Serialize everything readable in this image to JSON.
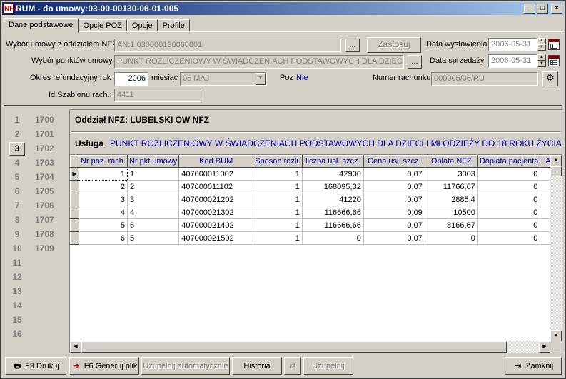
{
  "window": {
    "title": "RUM - do umowy:03-00-00130-06-01-005",
    "app_icon": "NFZ"
  },
  "tabs": [
    {
      "label": "Dane podstawowe",
      "active": true
    },
    {
      "label": "Opcje POZ"
    },
    {
      "label": "Opcje"
    },
    {
      "label": "Profile"
    }
  ],
  "form": {
    "umowa_label": "Wybór umowy z oddziałem NFZ",
    "umowa_value": "AN:1 030000130060001",
    "punkt_label": "Wybór punktów umowy",
    "punkt_value": "PUNKT ROZLICZENIOWY W ŚWIADCZENIACH PODSTAWOWYCH DLA DZIECI",
    "ellipsis": "...",
    "zastosuj": "Zastosuj",
    "data_wyst_label": "Data wystawienia",
    "data_wyst_value": "2006-05-31",
    "data_sprz_label": "Data sprzedaży",
    "data_sprz_value": "2006-05-31",
    "okres_label": "Okres refundacyjny",
    "rok_label": "rok",
    "rok_value": "2006",
    "miesiac_label": "miesiąc",
    "miesiac_value": "05 MAJ",
    "poz_label": "Poz",
    "poz_value": "Nie",
    "numer_label": "Numer rachunku",
    "numer_value": "000005/06/RU",
    "szablon_label": "Id Szablonu rach.:",
    "szablon_value": "4411"
  },
  "left_list": [
    {
      "n": "1",
      "v": "1700"
    },
    {
      "n": "2",
      "v": "1701"
    },
    {
      "n": "3",
      "v": "1702",
      "selected": true
    },
    {
      "n": "4",
      "v": "1703"
    },
    {
      "n": "5",
      "v": "1704"
    },
    {
      "n": "6",
      "v": "1705"
    },
    {
      "n": "7",
      "v": "1706"
    },
    {
      "n": "8",
      "v": "1707"
    },
    {
      "n": "9",
      "v": "1708"
    },
    {
      "n": "10",
      "v": "1709"
    },
    {
      "n": "11",
      "v": ""
    },
    {
      "n": "12",
      "v": ""
    },
    {
      "n": "13",
      "v": ""
    },
    {
      "n": "14",
      "v": ""
    },
    {
      "n": "15",
      "v": ""
    },
    {
      "n": "16",
      "v": ""
    }
  ],
  "main": {
    "oddzial": "Oddział NFZ: LUBELSKI OW NFZ",
    "usluga_label": "Usługa",
    "usluga_value": "PUNKT ROZLICZENIOWY W ŚWIADCZENIACH PODSTAWOWYCH DLA DZIECI I MŁODZIEŻY DO 18 ROKU ŻYCIA"
  },
  "grid": {
    "columns": [
      "Nr poz. rach.",
      "Nr pkt umowy",
      "Kod BUM",
      "Sposob rozli.",
      "liczba usł. szcz.",
      "Cena usł. szcz.",
      "Opłata NFZ",
      "Dopłata pacjenta",
      "'A'"
    ],
    "rows": [
      [
        "1",
        "1",
        "407000011002",
        "1",
        "42900",
        "0,07",
        "3003",
        "0"
      ],
      [
        "2",
        "2",
        "407000011102",
        "1",
        "168095,32",
        "0,07",
        "11766,67",
        "0"
      ],
      [
        "3",
        "3",
        "407000021202",
        "1",
        "41220",
        "0,07",
        "2885,4",
        "0"
      ],
      [
        "4",
        "4",
        "407000021302",
        "1",
        "116666,66",
        "0,09",
        "10500",
        "0"
      ],
      [
        "5",
        "6",
        "407000021402",
        "1",
        "116666,66",
        "0,07",
        "8166,67",
        "0"
      ],
      [
        "6",
        "5",
        "407000021502",
        "1",
        "0",
        "0,07",
        "0",
        "0"
      ]
    ]
  },
  "bottom": {
    "drukuj": "F9 Drukuj",
    "generuj": "F6 Generuj plik",
    "uzupelnij_auto": "Uzupełnij automatycznie",
    "historia": "Historia",
    "uzupelnij": "Uzupełnij",
    "zamknij": "Zamknij"
  }
}
